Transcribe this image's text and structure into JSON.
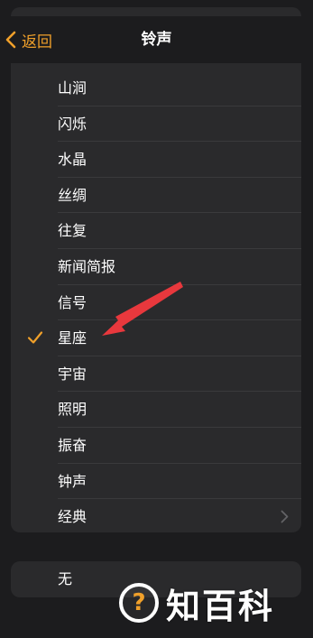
{
  "nav": {
    "back_label": "返回",
    "title": "铃声"
  },
  "list": {
    "items": [
      {
        "label": "山涧",
        "selected": false
      },
      {
        "label": "闪烁",
        "selected": false
      },
      {
        "label": "水晶",
        "selected": false
      },
      {
        "label": "丝绸",
        "selected": false
      },
      {
        "label": "往复",
        "selected": false
      },
      {
        "label": "新闻简报",
        "selected": false
      },
      {
        "label": "信号",
        "selected": false
      },
      {
        "label": "星座",
        "selected": true
      },
      {
        "label": "宇宙",
        "selected": false
      },
      {
        "label": "照明",
        "selected": false
      },
      {
        "label": "振奋",
        "selected": false
      },
      {
        "label": "钟声",
        "selected": false
      },
      {
        "label": "经典",
        "selected": false,
        "has_disclosure": true
      }
    ]
  },
  "none_option": {
    "label": "无"
  },
  "watermark": {
    "text": "知百科",
    "logo_glyph": "?"
  },
  "colors": {
    "accent": "#f0a02a",
    "annotation_arrow": "#e8383d",
    "background": "#1c1c1e",
    "card": "#2a2a2c"
  }
}
